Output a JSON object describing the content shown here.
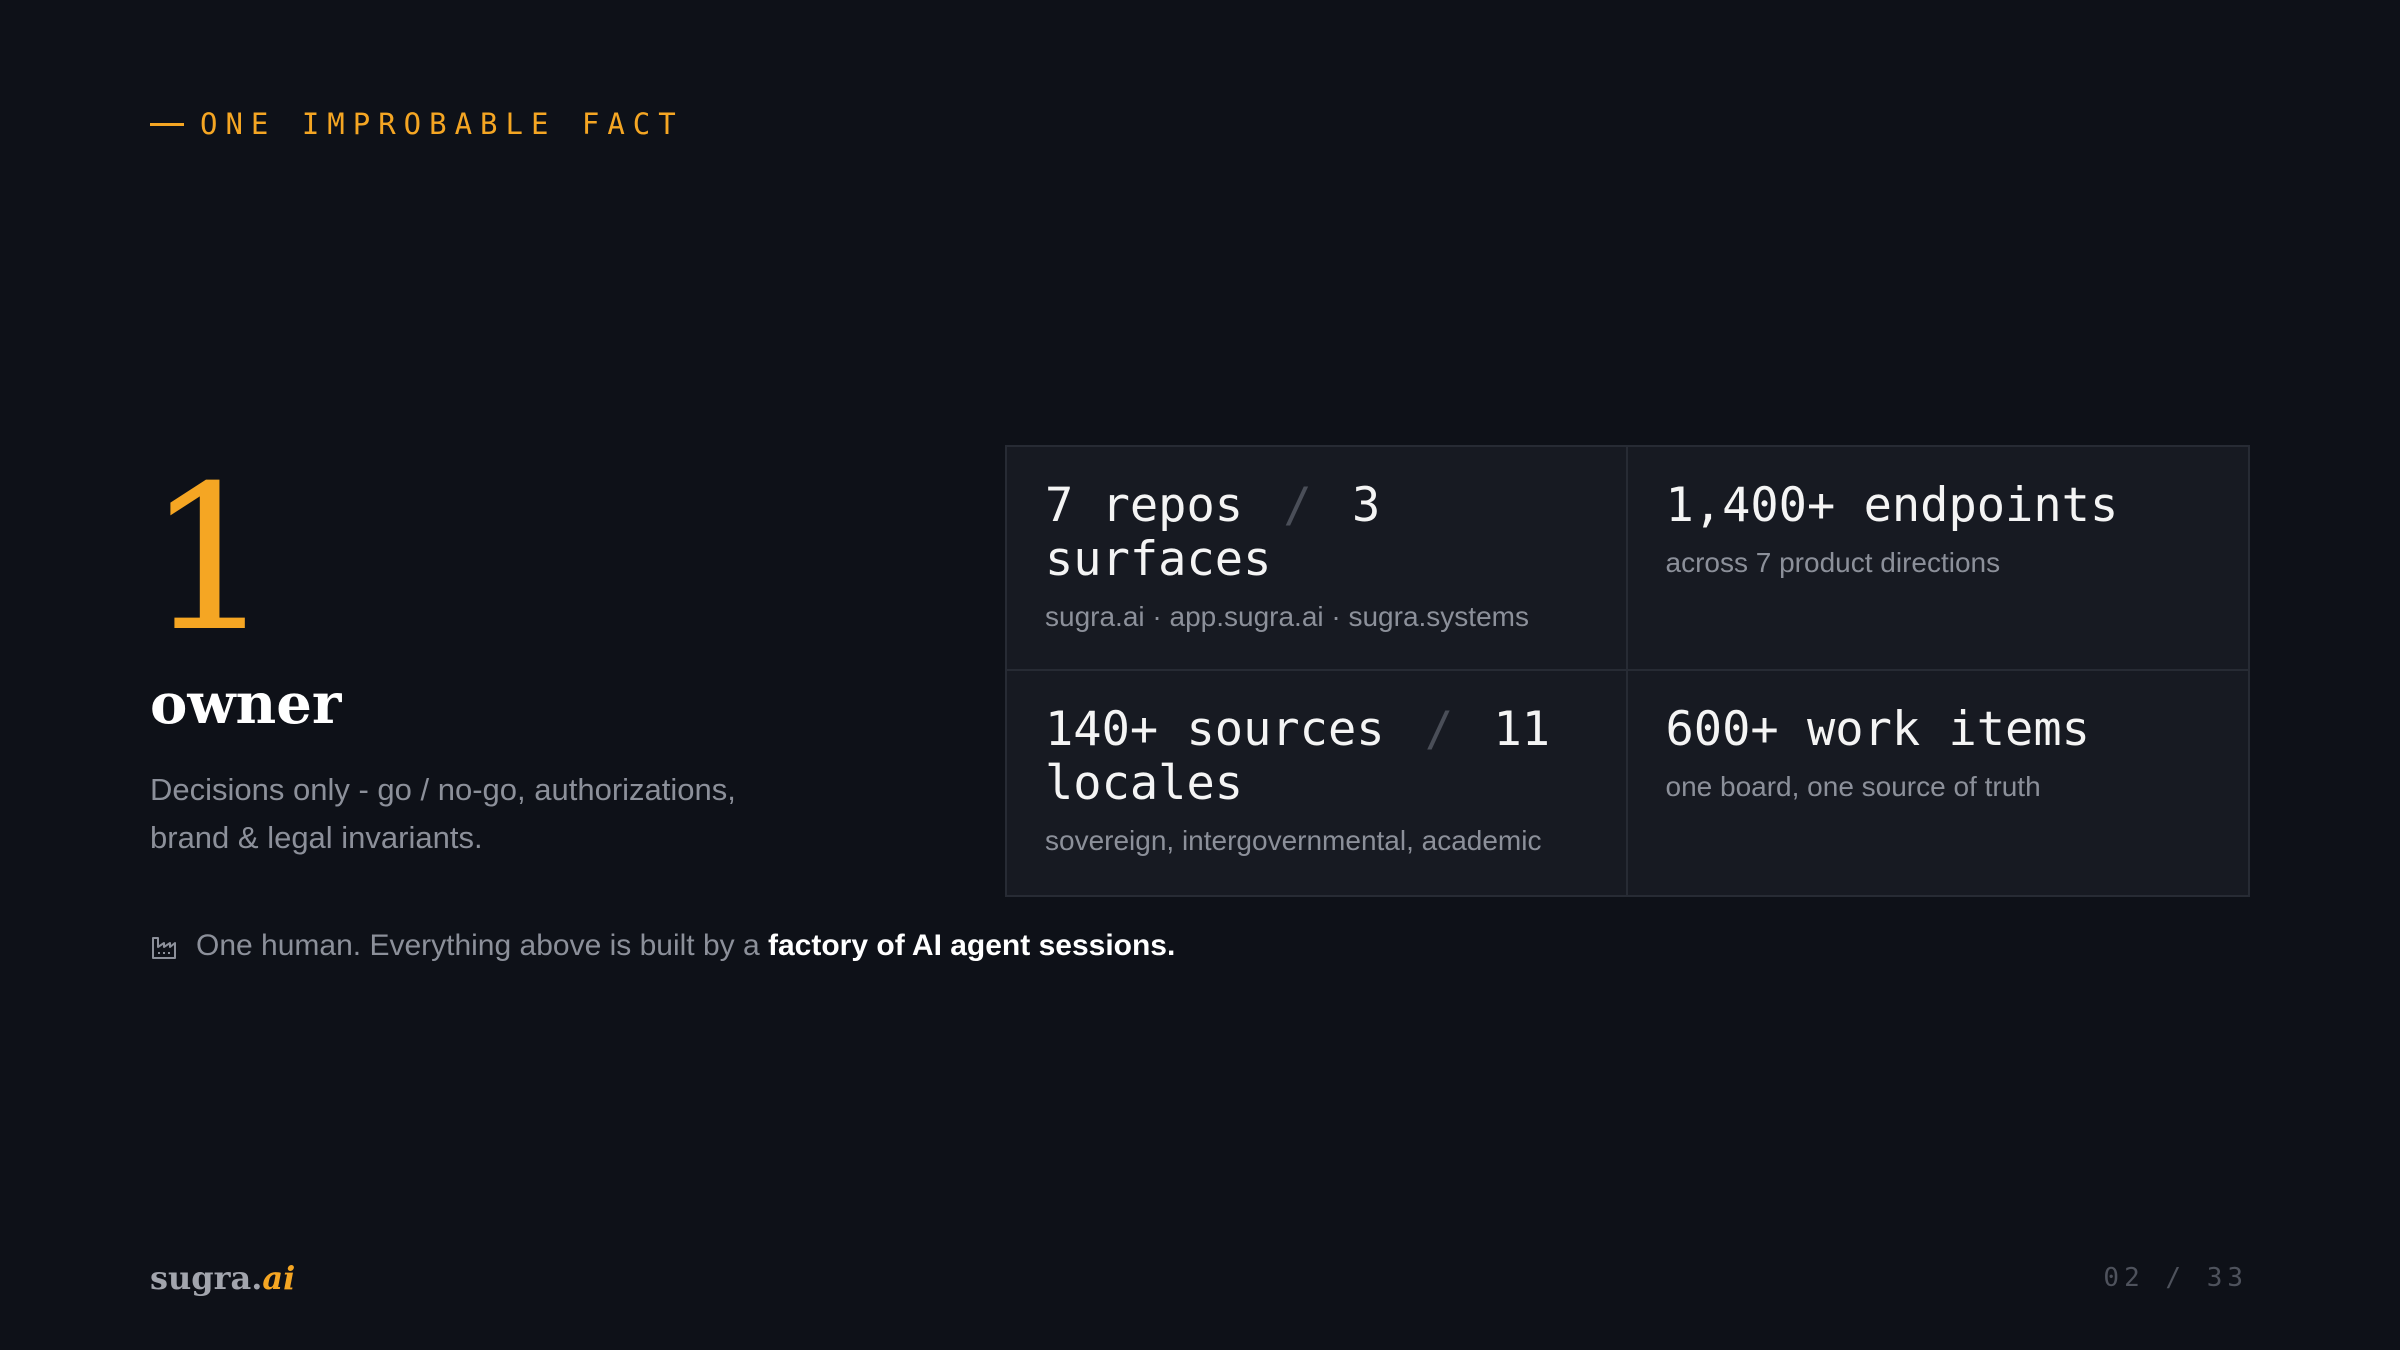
{
  "eyebrow": "ONE IMPROBABLE FACT",
  "hero": {
    "number": "1",
    "caption": "owner",
    "description": "Decisions only - go / no-go, authorizations, brand & legal invariants."
  },
  "stats": [
    {
      "title_a": "7 repos",
      "separator": "/",
      "title_b": "3 surfaces",
      "subtitle": "sugra.ai · app.sugra.ai · sugra.systems"
    },
    {
      "title_a": "1,400+ endpoints",
      "separator": "",
      "title_b": "",
      "subtitle": "across 7 product directions"
    },
    {
      "title_a": "140+ sources",
      "separator": "/",
      "title_b": "11 locales",
      "subtitle": "sovereign, intergovernmental, academic"
    },
    {
      "title_a": "600+ work items",
      "separator": "",
      "title_b": "",
      "subtitle": "one board, one source of truth"
    }
  ],
  "note": {
    "icon": "factory-icon",
    "text": "One human. Everything above is built by a ",
    "emphasis": "factory of AI agent sessions."
  },
  "footer": {
    "logo_main": "sugra.",
    "logo_accent": "ai",
    "page_indicator": "02 / 33"
  },
  "colors": {
    "background": "#0e1118",
    "accent": "#f5a623",
    "muted": "#8c909a",
    "card": "#171a22",
    "border": "#272b34"
  }
}
